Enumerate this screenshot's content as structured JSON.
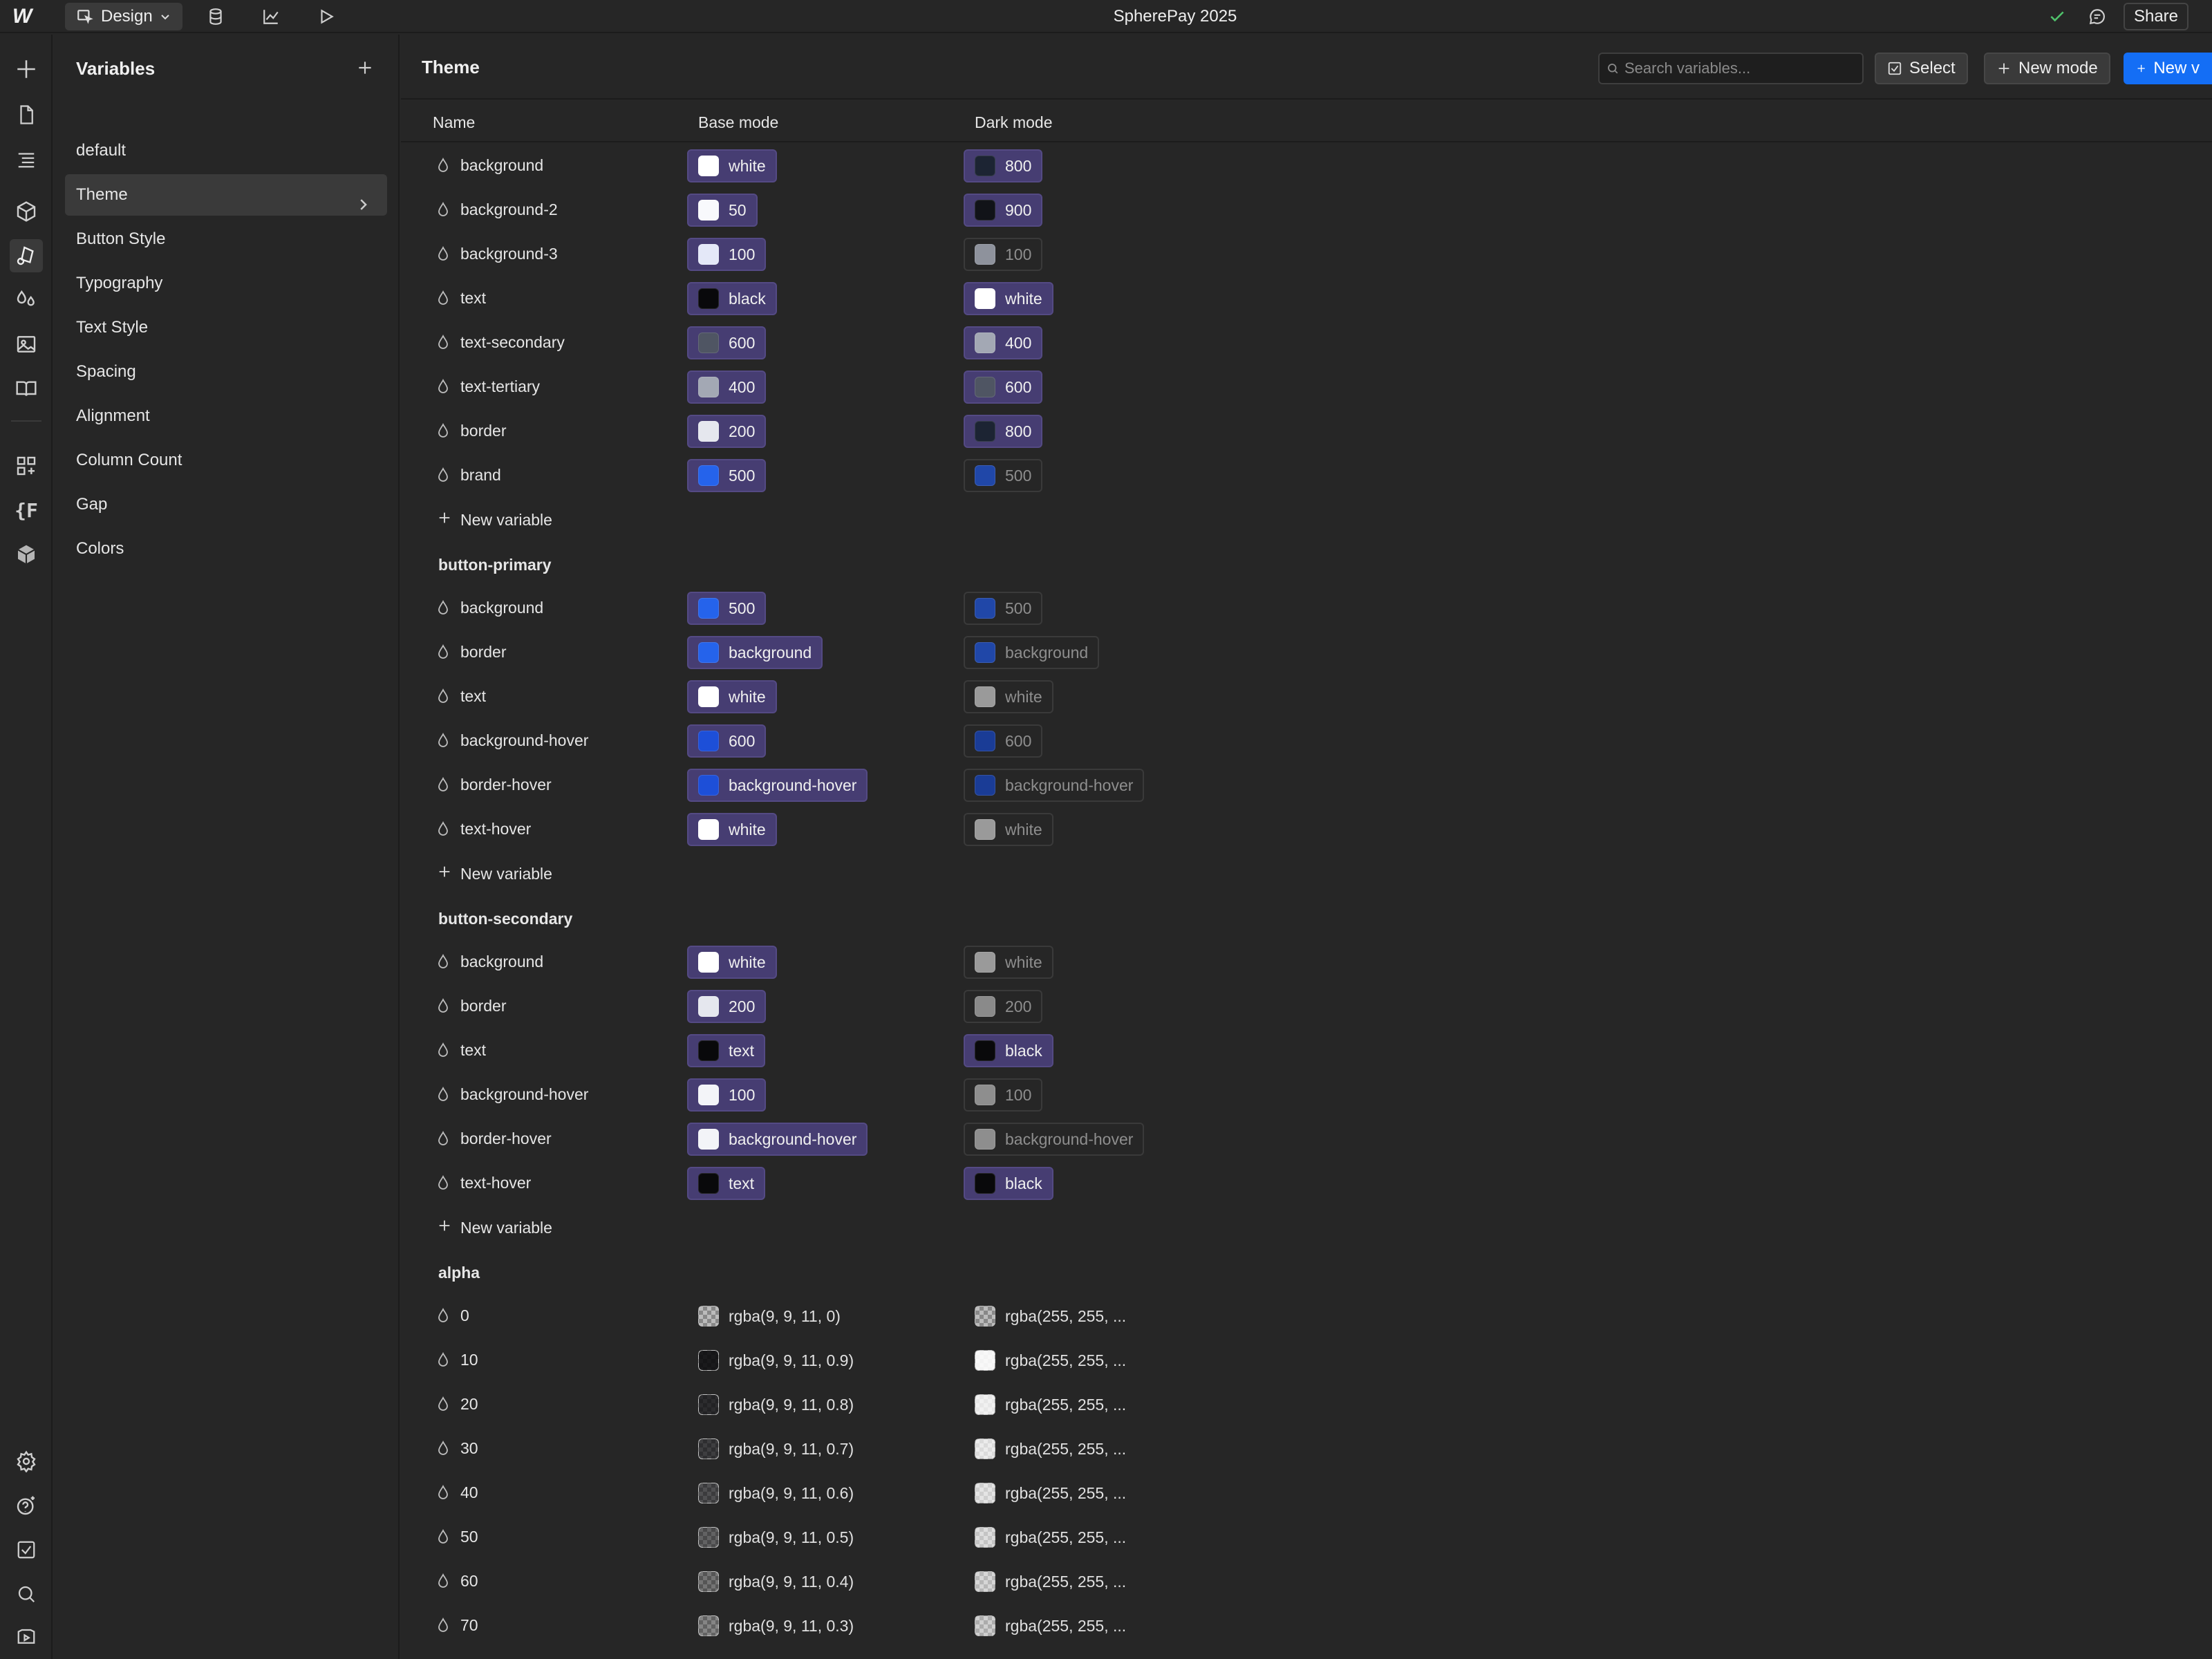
{
  "app": {
    "title": "SpherePay 2025",
    "share_label": "Share",
    "mode_label": "Design"
  },
  "panel": {
    "title": "Variables",
    "collections": [
      {
        "label": "default",
        "active": false
      },
      {
        "label": "Theme",
        "active": true
      },
      {
        "label": "Button Style",
        "active": false
      },
      {
        "label": "Typography",
        "active": false
      },
      {
        "label": "Text Style",
        "active": false
      },
      {
        "label": "Spacing",
        "active": false
      },
      {
        "label": "Alignment",
        "active": false
      },
      {
        "label": "Column Count",
        "active": false
      },
      {
        "label": "Gap",
        "active": false
      },
      {
        "label": "Colors",
        "active": false
      }
    ]
  },
  "main": {
    "title": "Theme",
    "search_placeholder": "Search variables...",
    "select_label": "Select",
    "new_mode_label": "New mode",
    "new_var_label": "New v",
    "col_name": "Name",
    "col_base": "Base mode",
    "col_dark": "Dark mode"
  },
  "new_variable_label": "New variable",
  "groups": [
    {
      "title": "",
      "vars": [
        {
          "name": "background",
          "base": {
            "label": "white",
            "color": "#ffffff",
            "style": "on"
          },
          "dark": {
            "label": "800",
            "color": "#1c2433",
            "style": "on"
          }
        },
        {
          "name": "background-2",
          "base": {
            "label": "50",
            "color": "#f8f9fc",
            "style": "on"
          },
          "dark": {
            "label": "900",
            "color": "#111318",
            "style": "on"
          }
        },
        {
          "name": "background-3",
          "base": {
            "label": "100",
            "color": "#e4e8f8",
            "style": "on"
          },
          "dark": {
            "label": "100",
            "color": "#8e929c",
            "style": "off"
          }
        },
        {
          "name": "text",
          "base": {
            "label": "black",
            "color": "#09090b",
            "style": "on"
          },
          "dark": {
            "label": "white",
            "color": "#ffffff",
            "style": "on"
          }
        },
        {
          "name": "text-secondary",
          "base": {
            "label": "600",
            "color": "#4f5563",
            "style": "on"
          },
          "dark": {
            "label": "400",
            "color": "#a3a8b4",
            "style": "on"
          }
        },
        {
          "name": "text-tertiary",
          "base": {
            "label": "400",
            "color": "#a3a8b4",
            "style": "on"
          },
          "dark": {
            "label": "600",
            "color": "#4f5563",
            "style": "on"
          }
        },
        {
          "name": "border",
          "base": {
            "label": "200",
            "color": "#e5e7ee",
            "style": "on"
          },
          "dark": {
            "label": "800",
            "color": "#1c2433",
            "style": "on"
          }
        },
        {
          "name": "brand",
          "base": {
            "label": "500",
            "color": "#2563eb",
            "style": "on"
          },
          "dark": {
            "label": "500",
            "color": "#2047a8",
            "style": "off"
          }
        }
      ]
    },
    {
      "title": "button-primary",
      "vars": [
        {
          "name": "background",
          "base": {
            "label": "500",
            "color": "#2563eb",
            "style": "on"
          },
          "dark": {
            "label": "500",
            "color": "#2047a8",
            "style": "off"
          }
        },
        {
          "name": "border",
          "base": {
            "label": "background",
            "color": "#2563eb",
            "style": "on"
          },
          "dark": {
            "label": "background",
            "color": "#2047a8",
            "style": "off"
          }
        },
        {
          "name": "text",
          "base": {
            "label": "white",
            "color": "#ffffff",
            "style": "on"
          },
          "dark": {
            "label": "white",
            "color": "#9a9a9a",
            "style": "off"
          }
        },
        {
          "name": "background-hover",
          "base": {
            "label": "600",
            "color": "#1d4fd8",
            "style": "on"
          },
          "dark": {
            "label": "600",
            "color": "#1a3c96",
            "style": "off"
          }
        },
        {
          "name": "border-hover",
          "base": {
            "label": "background-hover",
            "color": "#1d4fd8",
            "style": "on"
          },
          "dark": {
            "label": "background-hover",
            "color": "#1a3c96",
            "style": "off"
          }
        },
        {
          "name": "text-hover",
          "base": {
            "label": "white",
            "color": "#ffffff",
            "style": "on"
          },
          "dark": {
            "label": "white",
            "color": "#9a9a9a",
            "style": "off"
          }
        }
      ]
    },
    {
      "title": "button-secondary",
      "vars": [
        {
          "name": "background",
          "base": {
            "label": "white",
            "color": "#ffffff",
            "style": "on"
          },
          "dark": {
            "label": "white",
            "color": "#9a9a9a",
            "style": "off"
          }
        },
        {
          "name": "border",
          "base": {
            "label": "200",
            "color": "#e5e7ee",
            "style": "on"
          },
          "dark": {
            "label": "200",
            "color": "#8a8a8a",
            "style": "off"
          }
        },
        {
          "name": "text",
          "base": {
            "label": "text",
            "color": "#09090b",
            "style": "on"
          },
          "dark": {
            "label": "black",
            "color": "#09090b",
            "style": "on"
          }
        },
        {
          "name": "background-hover",
          "base": {
            "label": "100",
            "color": "#f3f4f8",
            "style": "on"
          },
          "dark": {
            "label": "100",
            "color": "#8e8e8e",
            "style": "off"
          }
        },
        {
          "name": "border-hover",
          "base": {
            "label": "background-hover",
            "color": "#f3f4f8",
            "style": "on"
          },
          "dark": {
            "label": "background-hover",
            "color": "#8e8e8e",
            "style": "off"
          }
        },
        {
          "name": "text-hover",
          "base": {
            "label": "text",
            "color": "#09090b",
            "style": "on"
          },
          "dark": {
            "label": "black",
            "color": "#09090b",
            "style": "on"
          }
        }
      ]
    },
    {
      "title": "alpha",
      "vars": [
        {
          "name": "0",
          "base": {
            "label": "rgba(9, 9, 11, 0)",
            "color": "rgba(9,9,11,0)",
            "style": "plain",
            "alpha": true
          },
          "dark": {
            "label": "rgba(255, 255, ...",
            "color": "rgba(255,255,255,0)",
            "style": "plain",
            "alpha": true
          }
        },
        {
          "name": "10",
          "base": {
            "label": "rgba(9, 9, 11, 0.9)",
            "color": "rgba(9,9,11,0.9)",
            "style": "plain",
            "alpha": true
          },
          "dark": {
            "label": "rgba(255, 255, ...",
            "color": "rgba(255,255,255,0.9)",
            "style": "plain",
            "alpha": true
          }
        },
        {
          "name": "20",
          "base": {
            "label": "rgba(9, 9, 11, 0.8)",
            "color": "rgba(9,9,11,0.8)",
            "style": "plain",
            "alpha": true
          },
          "dark": {
            "label": "rgba(255, 255, ...",
            "color": "rgba(255,255,255,0.8)",
            "style": "plain",
            "alpha": true
          }
        },
        {
          "name": "30",
          "base": {
            "label": "rgba(9, 9, 11, 0.7)",
            "color": "rgba(9,9,11,0.7)",
            "style": "plain",
            "alpha": true
          },
          "dark": {
            "label": "rgba(255, 255, ...",
            "color": "rgba(255,255,255,0.7)",
            "style": "plain",
            "alpha": true
          }
        },
        {
          "name": "40",
          "base": {
            "label": "rgba(9, 9, 11, 0.6)",
            "color": "rgba(9,9,11,0.6)",
            "style": "plain",
            "alpha": true
          },
          "dark": {
            "label": "rgba(255, 255, ...",
            "color": "rgba(255,255,255,0.6)",
            "style": "plain",
            "alpha": true
          }
        },
        {
          "name": "50",
          "base": {
            "label": "rgba(9, 9, 11, 0.5)",
            "color": "rgba(9,9,11,0.5)",
            "style": "plain",
            "alpha": true
          },
          "dark": {
            "label": "rgba(255, 255, ...",
            "color": "rgba(255,255,255,0.5)",
            "style": "plain",
            "alpha": true
          }
        },
        {
          "name": "60",
          "base": {
            "label": "rgba(9, 9, 11, 0.4)",
            "color": "rgba(9,9,11,0.4)",
            "style": "plain",
            "alpha": true
          },
          "dark": {
            "label": "rgba(255, 255, ...",
            "color": "rgba(255,255,255,0.4)",
            "style": "plain",
            "alpha": true
          }
        },
        {
          "name": "70",
          "base": {
            "label": "rgba(9, 9, 11, 0.3)",
            "color": "rgba(9,9,11,0.3)",
            "style": "plain",
            "alpha": true
          },
          "dark": {
            "label": "rgba(255, 255, ...",
            "color": "rgba(255,255,255,0.3)",
            "style": "plain",
            "alpha": true
          }
        }
      ]
    }
  ],
  "colors": {
    "accent": "#146ef5",
    "chip_bg": "#463d72",
    "bg": "#262626"
  }
}
